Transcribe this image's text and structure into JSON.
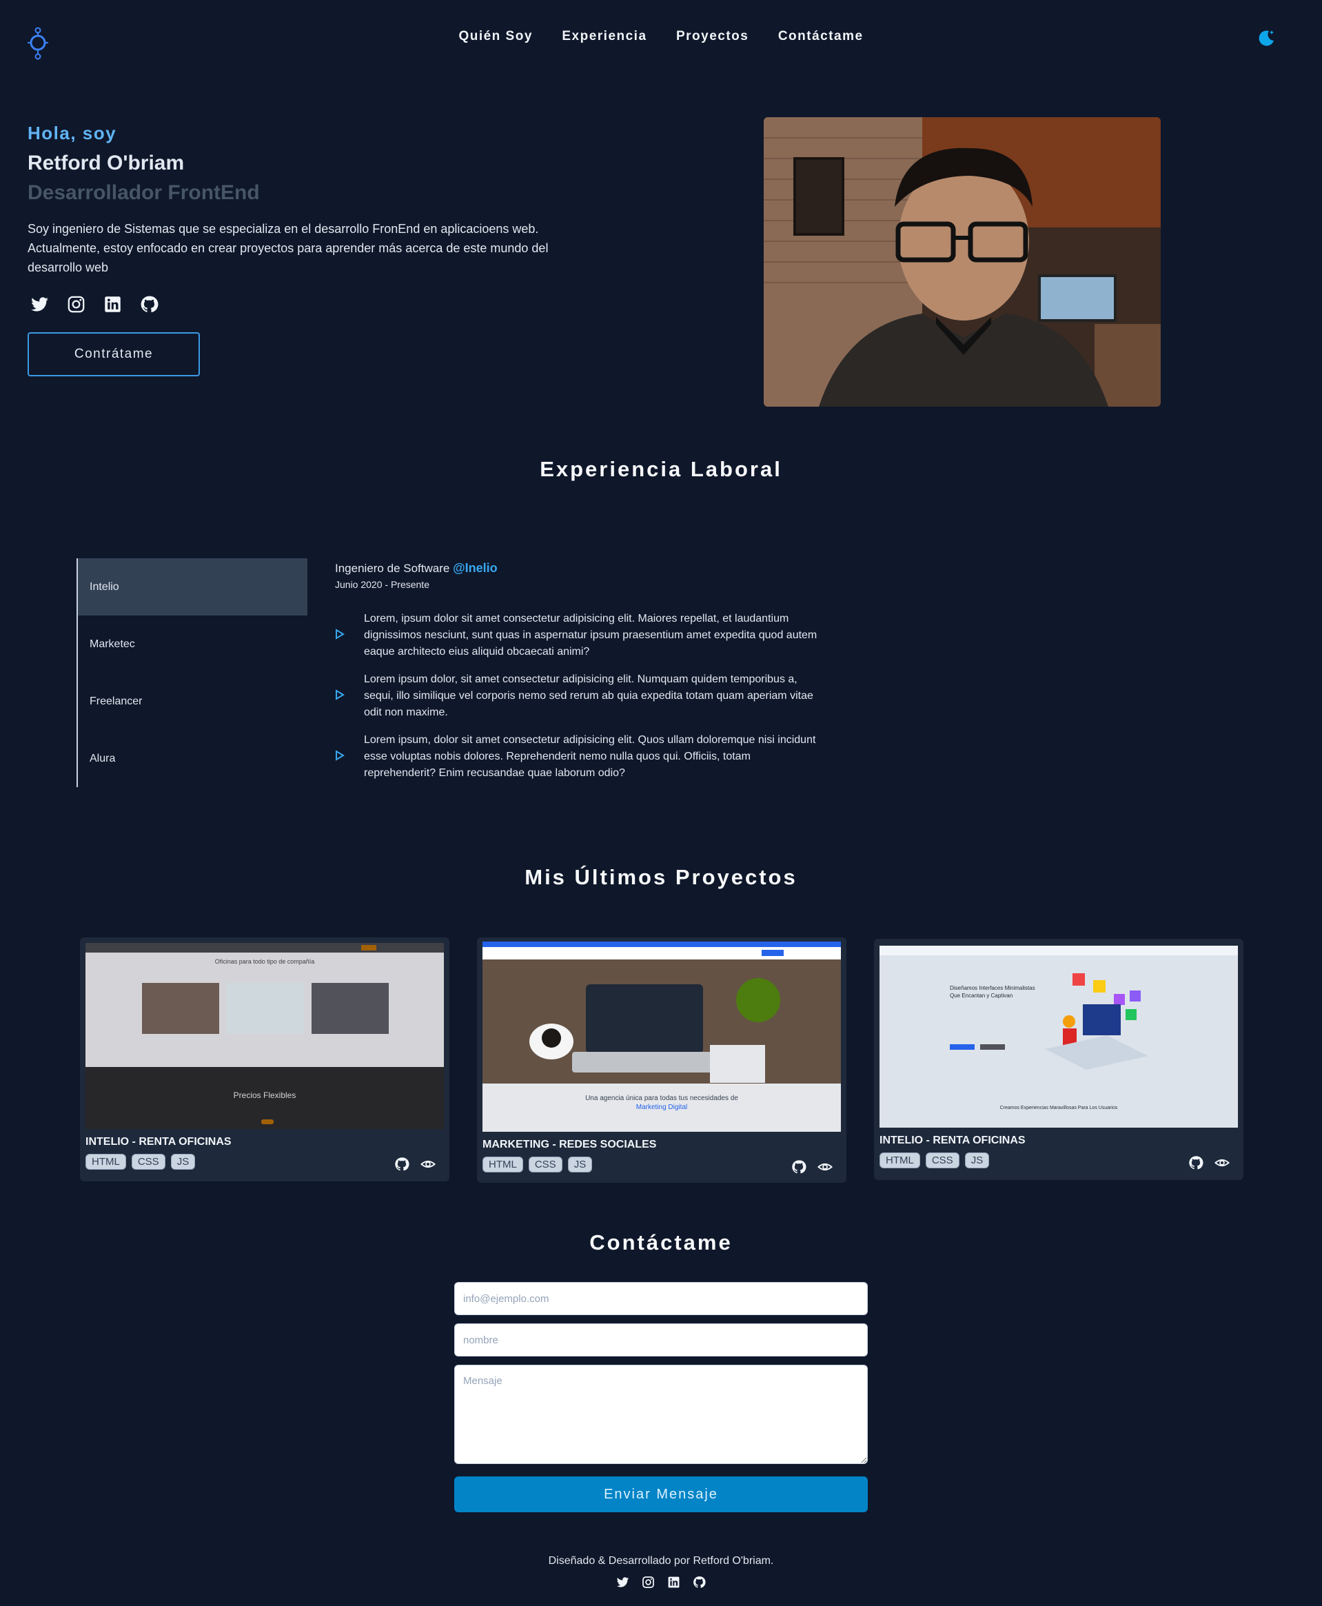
{
  "nav": {
    "items": [
      "Quién Soy",
      "Experiencia",
      "Proyectos",
      "Contáctame"
    ]
  },
  "hero": {
    "greeting": "Hola, soy",
    "name": "Retford O'briam",
    "role": "Desarrollador FrontEnd",
    "bio": "Soy ingeniero de Sistemas que se especializa en el desarrollo FronEnd en aplicacioens web. Actualmente, estoy enfocado en crear proyectos para aprender más acerca de este mundo del desarrollo web",
    "socials": [
      "twitter-icon",
      "instagram-icon",
      "linkedin-icon",
      "github-icon"
    ],
    "cta": "Contrátame"
  },
  "experience": {
    "title": "Experiencia Laboral",
    "tabs": [
      "Intelio",
      "Marketec",
      "Freelancer",
      "Alura"
    ],
    "active_tab": "Intelio",
    "position": "Ingeniero de Software",
    "company": "@Inelio",
    "period": "Junio 2020 - Presente",
    "bullets": [
      "Lorem, ipsum dolor sit amet consectetur adipisicing elit. Maiores repellat, et laudantium dignissimos nesciunt, sunt quas in aspernatur ipsum praesentium amet expedita quod autem eaque architecto eius aliquid obcaecati animi?",
      "Lorem ipsum dolor, sit amet consectetur adipisicing elit. Numquam quidem temporibus a, sequi, illo similique vel corporis nemo sed rerum ab quia expedita totam quam aperiam vitae odit non maxime.",
      "Lorem ipsum, dolor sit amet consectetur adipisicing elit. Quos ullam doloremque nisi incidunt esse voluptas nobis dolores. Reprehenderit nemo nulla quos qui. Officiis, totam reprehenderit? Enim recusandae quae laborum odio?"
    ]
  },
  "projects": {
    "title": "Mis Últimos Proyectos",
    "items": [
      {
        "title": "INTELIO - RENTA OFICINAS",
        "tags": [
          "HTML",
          "CSS",
          "JS"
        ],
        "thumb": {
          "heading": "Oficinas para todo tipo de compañía",
          "footer_heading": "Precios Flexibles"
        }
      },
      {
        "title": "MARKETING - REDES SOCIALES",
        "tags": [
          "HTML",
          "CSS",
          "JS"
        ],
        "thumb": {
          "tagline": "Una agencia única para todas tus necesidades de",
          "accent": "Marketing Digital"
        }
      },
      {
        "title": "INTELIO - RENTA OFICINAS",
        "tags": [
          "HTML",
          "CSS",
          "JS"
        ],
        "thumb": {
          "heading": "Diseñamos Interfaces Minimalistas Que Encantan y Captivan",
          "footer_heading": "Creamos Experiencias Maravillosas Para Los Usuarios"
        }
      }
    ]
  },
  "contact": {
    "title": "Contáctame",
    "email_placeholder": "info@ejemplo.com",
    "name_placeholder": "nombre",
    "message_placeholder": "Mensaje",
    "submit": "Enviar Mensaje"
  },
  "footer": {
    "credit": "Diseñado & Desarrollado por Retford O'briam."
  },
  "colors": {
    "background": "#0f172a",
    "accent": "#38a8f0",
    "card": "#1e293b",
    "button": "#0284c7"
  }
}
